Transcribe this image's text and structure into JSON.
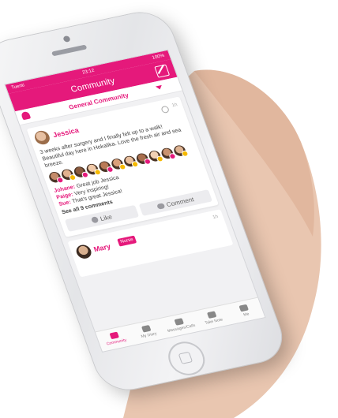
{
  "status_bar": {
    "carrier": "Tuenti",
    "time": "23:12",
    "battery": "100%"
  },
  "header": {
    "title": "Community"
  },
  "subheader": {
    "label": "General Community"
  },
  "post": {
    "author": "Jessica",
    "time": "1h",
    "text": "3 weeks after surgery and I finally felt up to a walk! Beautiful day here in Hokalika. Love the fresh air and sea breeze.",
    "comments": [
      {
        "author": "Johane:",
        "text": "Great job Jessica"
      },
      {
        "author": "Paige:",
        "text": "Very inspiring!"
      },
      {
        "author": "Sue:",
        "text": "That's great Jessica!"
      }
    ],
    "see_all": "See all 9 comments",
    "like_label": "Like",
    "comment_label": "Comment"
  },
  "post2": {
    "author": "Mary",
    "badge": "Nurse",
    "time": "1h"
  },
  "tabs": [
    {
      "label": "Community",
      "active": true
    },
    {
      "label": "My Diary"
    },
    {
      "label": "Messages/Calls"
    },
    {
      "label": "Take Note"
    },
    {
      "label": "Me"
    }
  ],
  "colors": {
    "accent": "#e5197b"
  },
  "reaction_badges": [
    "#e5197b",
    "#f6b900",
    "#e5197b",
    "#f6b900",
    "#e5197b",
    "#f6b900",
    "#f6b900",
    "#e5197b",
    "#f6b900",
    "#e5197b",
    "#f6b900"
  ]
}
